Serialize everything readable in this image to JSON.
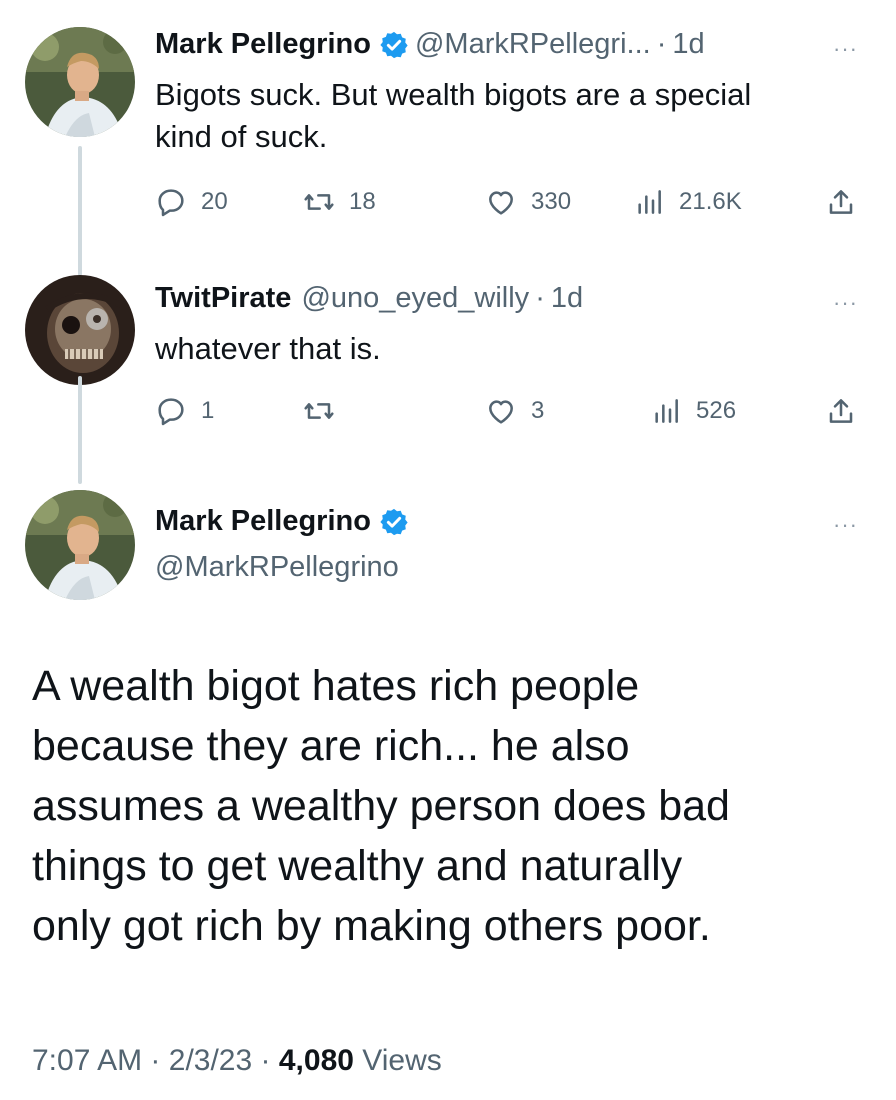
{
  "tweet1": {
    "name": "Mark Pellegrino",
    "handle": "@MarkRPellegri...",
    "sep": "·",
    "time": "1d",
    "more": "···",
    "text_line1": "Bigots suck. But wealth bigots are a special",
    "text_line2": "kind of suck.",
    "replies": "20",
    "retweets": "18",
    "likes": "330",
    "views": "21.6K"
  },
  "tweet2": {
    "name": "TwitPirate",
    "handle": "@uno_eyed_willy",
    "sep": "·",
    "time": "1d",
    "more": "···",
    "text": "whatever that is.",
    "replies": "1",
    "retweets": "",
    "likes": "3",
    "views": "526"
  },
  "tweet3": {
    "name": "Mark Pellegrino",
    "handle": "@MarkRPellegrino",
    "more": "···",
    "lines": [
      "A wealth bigot hates rich people",
      "because they are rich... he also",
      "assumes a wealthy person does bad",
      "things to get wealthy and naturally",
      "only got rich by making others poor."
    ],
    "time": "7:07 AM",
    "date": "2/3/23",
    "sep": "·",
    "views_count": "4,080",
    "views_label": "Views"
  },
  "colors": {
    "verified": "#1d9bf0",
    "thread_line": "#cfd9de",
    "secondary_text": "#536471",
    "primary_text": "#0f1419"
  },
  "icons": [
    "reply-icon",
    "retweet-icon",
    "like-icon",
    "views-icon",
    "share-icon",
    "verified-badge-icon",
    "more-icon"
  ]
}
